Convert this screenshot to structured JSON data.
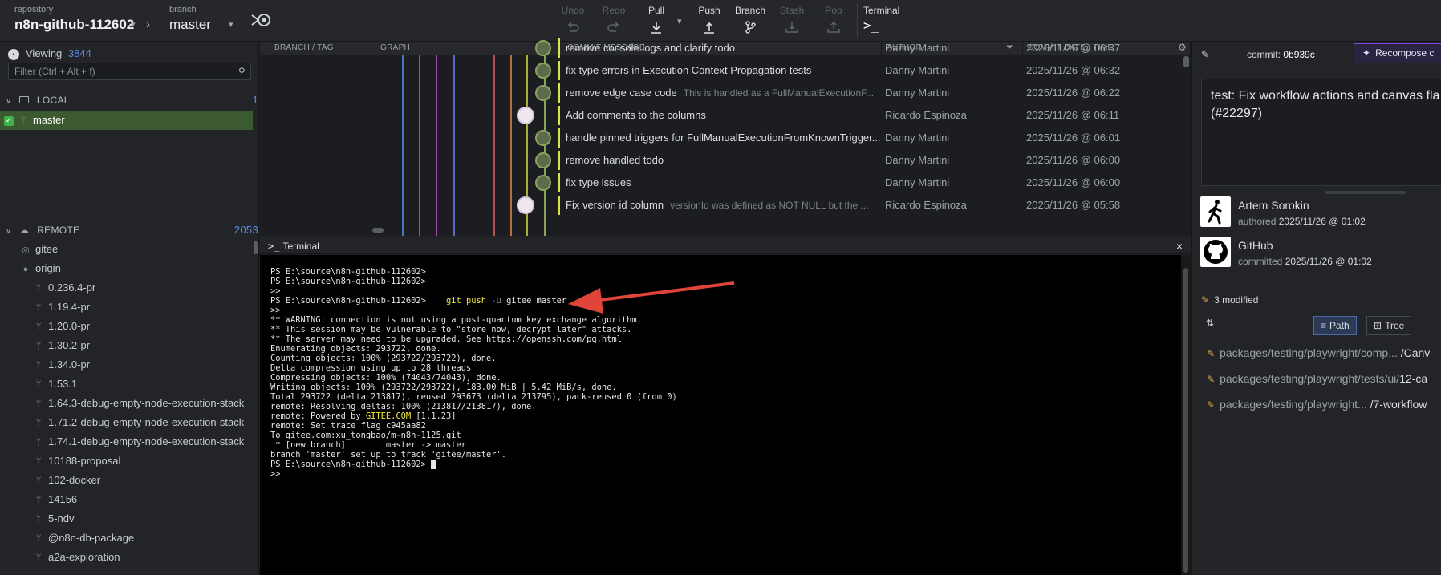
{
  "toolbar": {
    "repo_caption": "repository",
    "repo_name": "n8n-github-112602",
    "branch_caption": "branch",
    "branch_name": "master",
    "undo": "Undo",
    "redo": "Redo",
    "pull": "Pull",
    "push": "Push",
    "branch": "Branch",
    "stash": "Stash",
    "pop": "Pop",
    "terminal": "Terminal"
  },
  "sidebar": {
    "viewing_label": "Viewing",
    "viewing_count": "3844",
    "filter_placeholder": "Filter (Ctrl + Alt + f)",
    "local_label": "LOCAL",
    "local_count": "1",
    "local_branches": [
      "master"
    ],
    "remote_label": "REMOTE",
    "remote_count": "2053",
    "remotes": [
      "gitee",
      "origin"
    ],
    "origin_branches": [
      "0.236.4-pr",
      "1.19.4-pr",
      "1.20.0-pr",
      "1.30.2-pr",
      "1.34.0-pr",
      "1.53.1",
      "1.64.3-debug-empty-node-execution-stack",
      "1.71.2-debug-empty-node-execution-stack",
      "1.74.1-debug-empty-node-execution-stack",
      "10188-proposal",
      "102-docker",
      "14156",
      "5-ndv",
      "@n8n-db-package",
      "a2a-exploration"
    ]
  },
  "graph": {
    "columns": [
      "BRANCH / TAG",
      "GRAPH",
      "COMMIT MESSAGE",
      "AUTHOR",
      "COMMIT DATE / TIME"
    ],
    "rows": [
      {
        "message": "remove console.logs and clarify todo",
        "sub": "",
        "author": "Danny Martini",
        "date": "2025/11/26 @ 06:37"
      },
      {
        "message": "fix type errors in Execution Context Propagation tests",
        "sub": "",
        "author": "Danny Martini",
        "date": "2025/11/26 @ 06:32"
      },
      {
        "message": "remove edge case code",
        "sub": "This is handled as a FullManualExecutionF...",
        "author": "Danny Martini",
        "date": "2025/11/26 @ 06:22"
      },
      {
        "message": "Add comments to the columns",
        "sub": "",
        "author": "Ricardo Espinoza",
        "date": "2025/11/26 @ 06:11"
      },
      {
        "message": "handle pinned triggers for FullManualExecutionFromKnownTrigger...",
        "sub": "",
        "author": "Danny Martini",
        "date": "2025/11/26 @ 06:01"
      },
      {
        "message": "remove handled todo",
        "sub": "",
        "author": "Danny Martini",
        "date": "2025/11/26 @ 06:00"
      },
      {
        "message": "fix type issues",
        "sub": "",
        "author": "Danny Martini",
        "date": "2025/11/26 @ 06:00"
      },
      {
        "message": "Fix version id column",
        "sub": "versionId was defined as NOT NULL but the ...",
        "author": "Ricardo Espinoza",
        "date": "2025/11/26 @ 05:58"
      }
    ],
    "lane_colors": [
      "#4f8ff0",
      "#8f6cf0",
      "#c458d0",
      "#6a7cf0",
      "#e05a5a",
      "#e8823e",
      "#c9d43a"
    ]
  },
  "terminal": {
    "title": "Terminal",
    "lines": [
      "PS E:\\source\\n8n-github-112602>",
      "PS E:\\source\\n8n-github-112602>",
      ">>",
      "PS E:\\source\\n8n-github-112602>",
      ">>",
      "** WARNING: connection is not using a post-quantum key exchange algorithm.",
      "** This session may be vulnerable to \"store now, decrypt later\" attacks.",
      "** The server may need to be upgraded. See https://openssh.com/pq.html",
      "Enumerating objects: 293722, done.",
      "Counting objects: 100% (293722/293722), done.",
      "Delta compression using up to 28 threads",
      "Compressing objects: 100% (74043/74043), done.",
      "Writing objects: 100% (293722/293722), 183.00 MiB | 5.42 MiB/s, done.",
      "Total 293722 (delta 213817), reused 293673 (delta 213795), pack-reused 0 (from 0)",
      "remote: Resolving deltas: 100% (213817/213817), done.",
      "remote: Powered by ",
      "remote: Set trace flag c945aa82",
      "To gitee.com:xu_tongbao/m-n8n-1125.git",
      " * [new branch]        master -> master",
      "branch 'master' set up to track 'gitee/master'.",
      "PS E:\\source\\n8n-github-112602> ",
      ">>"
    ],
    "cmd_git": "git push",
    "cmd_flag": "-u",
    "cmd_rest": "gitee master",
    "powered_by": "GITEE.COM",
    "powered_ver": " [1.1.23]"
  },
  "right": {
    "commit_label": "commit:",
    "commit_sha": "0b939c",
    "recompose_label": "Recompose c",
    "message": "test: Fix workflow actions and canvas fla\n(#22297)",
    "author_name": "Artem Sorokin",
    "authored_label": "authored",
    "authored_date": "2025/11/26 @ 01:02",
    "committer_name": "GitHub",
    "committed_label": "committed",
    "committed_date": "2025/11/26 @ 01:02",
    "modified_label": "3 modified",
    "path_label": "Path",
    "tree_label": "Tree",
    "files": [
      {
        "dir": "packages/testing/playwright/comp...",
        "name": " /Canv"
      },
      {
        "dir": "packages/testing/playwright/tests/ui/",
        "name": "12-ca"
      },
      {
        "dir": "packages/testing/playwright...",
        "name": " /7-workflow"
      }
    ]
  }
}
